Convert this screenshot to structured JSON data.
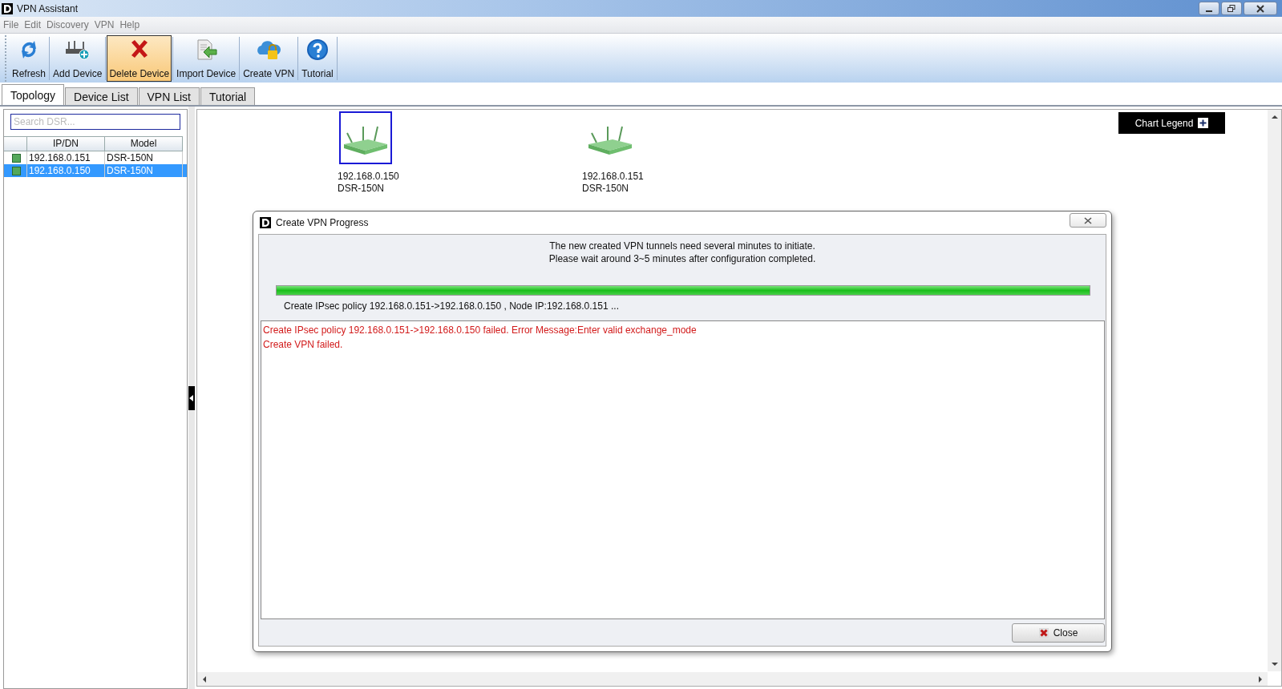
{
  "window": {
    "title": "VPN Assistant"
  },
  "menu": [
    "File",
    "Edit",
    "Discovery",
    "VPN",
    "Help"
  ],
  "toolbar": [
    {
      "label": "Refresh",
      "kind": "refresh",
      "selected": false
    },
    {
      "label": "Add Device",
      "kind": "add",
      "selected": false
    },
    {
      "label": "Delete Device",
      "kind": "delete",
      "selected": true
    },
    {
      "label": "Import Device",
      "kind": "import",
      "selected": false
    },
    {
      "label": "Create VPN",
      "kind": "vpn",
      "selected": false
    },
    {
      "label": "Tutorial",
      "kind": "help",
      "selected": false
    }
  ],
  "tabs": [
    {
      "label": "Topology",
      "selected": true
    },
    {
      "label": "Device List",
      "selected": false
    },
    {
      "label": "VPN List",
      "selected": false
    },
    {
      "label": "Tutorial",
      "selected": false
    }
  ],
  "search": {
    "placeholder": "Search DSR..."
  },
  "device_table": {
    "columns": [
      "IP/DN",
      "Model"
    ],
    "rows": [
      {
        "ip": "192.168.0.151",
        "model": "DSR-150N",
        "selected": false
      },
      {
        "ip": "192.168.0.150",
        "model": "DSR-150N",
        "selected": true
      }
    ]
  },
  "topology": {
    "devices": [
      {
        "ip": "192.168.0.150",
        "model": "DSR-150N",
        "selected": true
      },
      {
        "ip": "192.168.0.151",
        "model": "DSR-150N",
        "selected": false
      }
    ],
    "chart_legend": "Chart Legend"
  },
  "dialog": {
    "title": "Create VPN Progress",
    "message": [
      "The new created VPN tunnels need several minutes to initiate.",
      "Please wait around 3~5 minutes after configuration completed."
    ],
    "progress": {
      "level": 1.0
    },
    "status": "Create IPsec policy 192.168.0.151->192.168.0.150 , Node IP:192.168.0.151 ...",
    "log": [
      "Create IPsec policy 192.168.0.151->192.168.0.150 failed. Error Message:Enter valid exchange_mode",
      "Create VPN failed."
    ],
    "close_button": "Close"
  }
}
